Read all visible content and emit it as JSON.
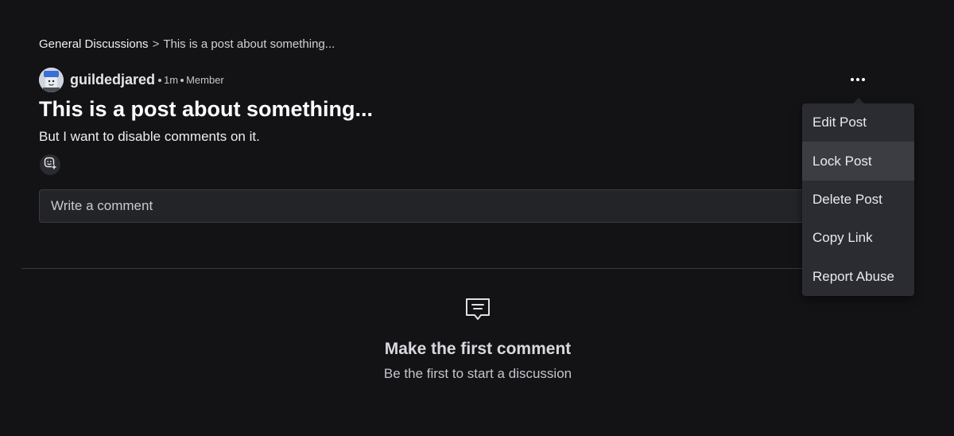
{
  "breadcrumb": {
    "root": "General Discussions",
    "separator": ">",
    "current": "This is a post about something..."
  },
  "post": {
    "author": "guildedjared",
    "time": "1m",
    "role": "Member",
    "title": "This is a post about something...",
    "body": "But I want to disable comments on it."
  },
  "comment": {
    "placeholder": "Write a comment"
  },
  "empty_state": {
    "title": "Make the first comment",
    "subtitle": "Be the first to start a discussion"
  },
  "menu": {
    "items": [
      {
        "label": "Edit Post"
      },
      {
        "label": "Lock Post"
      },
      {
        "label": "Delete Post"
      },
      {
        "label": "Copy Link"
      },
      {
        "label": "Report Abuse"
      }
    ],
    "highlighted_index": 1
  },
  "icons": {
    "reaction": "add-reaction-icon",
    "more": "more-options-icon",
    "comment": "comment-icon"
  },
  "colors": {
    "background": "#131316",
    "menu_background": "#2b2c31",
    "menu_highlight": "#3c3d43",
    "input_background": "#232428"
  }
}
